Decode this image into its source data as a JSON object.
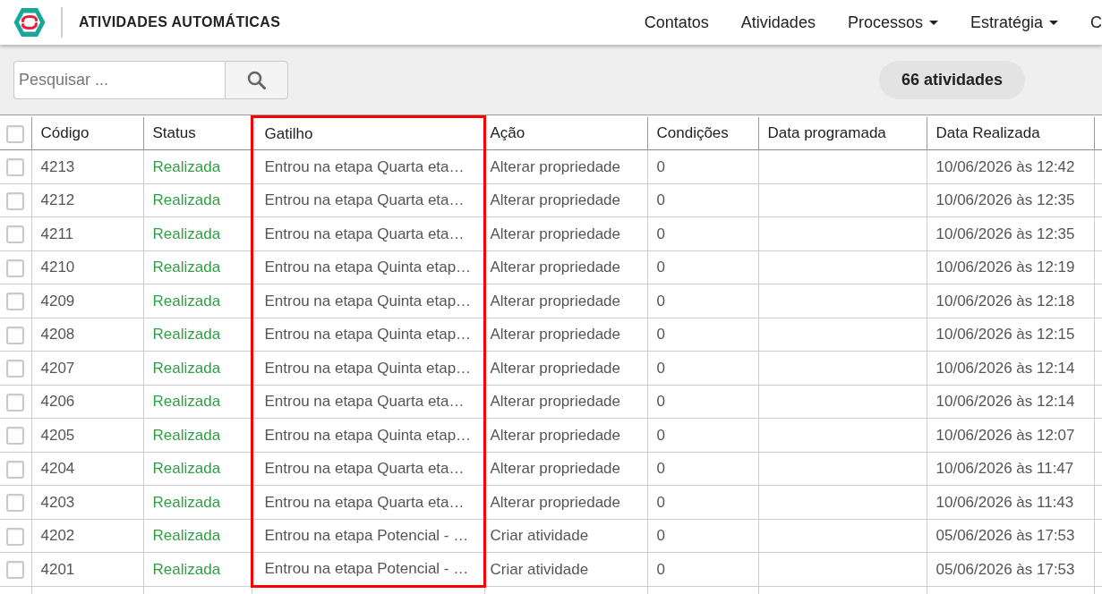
{
  "app": {
    "title": "ATIVIDADES AUTOMÁTICAS"
  },
  "nav": [
    {
      "label": "Contatos",
      "dropdown": false
    },
    {
      "label": "Atividades",
      "dropdown": false
    },
    {
      "label": "Processos",
      "dropdown": true
    },
    {
      "label": "Estratégia",
      "dropdown": true
    },
    {
      "label": "C",
      "dropdown": false
    }
  ],
  "search": {
    "placeholder": "Pesquisar ..."
  },
  "count_badge": "66 atividades",
  "table": {
    "select_all": {
      "checked": false
    },
    "columns": [
      {
        "label": "Código",
        "highlighted": false
      },
      {
        "label": "Status",
        "highlighted": false
      },
      {
        "label": "Gatilho",
        "highlighted": true
      },
      {
        "label": "Ação",
        "highlighted": false
      },
      {
        "label": "Condições",
        "highlighted": false
      },
      {
        "label": "Data programada",
        "highlighted": false
      },
      {
        "label": "Data Realizada",
        "highlighted": false
      }
    ],
    "rows": [
      {
        "checked": false,
        "code": "4213",
        "status": {
          "text": "Realizada",
          "kind": "done"
        },
        "trigger": "Entrou na etapa Quarta eta…",
        "action": "Alterar propriedade",
        "conditions": "0",
        "completed_date": "10/06/2026 às 12:42"
      },
      {
        "checked": false,
        "code": "4212",
        "status": {
          "text": "Realizada",
          "kind": "done"
        },
        "trigger": "Entrou na etapa Quarta eta…",
        "action": "Alterar propriedade",
        "conditions": "0",
        "completed_date": "10/06/2026 às 12:35"
      },
      {
        "checked": false,
        "code": "4211",
        "status": {
          "text": "Realizada",
          "kind": "done"
        },
        "trigger": "Entrou na etapa Quarta eta…",
        "action": "Alterar propriedade",
        "conditions": "0",
        "completed_date": "10/06/2026 às 12:35"
      },
      {
        "checked": false,
        "code": "4210",
        "status": {
          "text": "Realizada",
          "kind": "done"
        },
        "trigger": "Entrou na etapa Quinta etap…",
        "action": "Alterar propriedade",
        "conditions": "0",
        "completed_date": "10/06/2026 às 12:19"
      },
      {
        "checked": false,
        "code": "4209",
        "status": {
          "text": "Realizada",
          "kind": "done"
        },
        "trigger": "Entrou na etapa Quinta etap…",
        "action": "Alterar propriedade",
        "conditions": "0",
        "completed_date": "10/06/2026 às 12:18"
      },
      {
        "checked": false,
        "code": "4208",
        "status": {
          "text": "Realizada",
          "kind": "done"
        },
        "trigger": "Entrou na etapa Quinta etap…",
        "action": "Alterar propriedade",
        "conditions": "0",
        "completed_date": "10/06/2026 às 12:15"
      },
      {
        "checked": false,
        "code": "4207",
        "status": {
          "text": "Realizada",
          "kind": "done"
        },
        "trigger": "Entrou na etapa Quinta etap…",
        "action": "Alterar propriedade",
        "conditions": "0",
        "completed_date": "10/06/2026 às 12:14"
      },
      {
        "checked": false,
        "code": "4206",
        "status": {
          "text": "Realizada",
          "kind": "done"
        },
        "trigger": "Entrou na etapa Quarta eta…",
        "action": "Alterar propriedade",
        "conditions": "0",
        "completed_date": "10/06/2026 às 12:14"
      },
      {
        "checked": false,
        "code": "4205",
        "status": {
          "text": "Realizada",
          "kind": "done"
        },
        "trigger": "Entrou na etapa Quinta etap…",
        "action": "Alterar propriedade",
        "conditions": "0",
        "completed_date": "10/06/2026 às 12:07"
      },
      {
        "checked": false,
        "code": "4204",
        "status": {
          "text": "Realizada",
          "kind": "done"
        },
        "trigger": "Entrou na etapa Quarta eta…",
        "action": "Alterar propriedade",
        "conditions": "0",
        "completed_date": "10/06/2026 às 11:47"
      },
      {
        "checked": false,
        "code": "4203",
        "status": {
          "text": "Realizada",
          "kind": "done"
        },
        "trigger": "Entrou na etapa Quarta eta…",
        "action": "Alterar propriedade",
        "conditions": "0",
        "completed_date": "10/06/2026 às 11:43"
      },
      {
        "checked": false,
        "code": "4202",
        "status": {
          "text": "Realizada",
          "kind": "done"
        },
        "trigger": "Entrou na etapa Potencial - …",
        "action": "Criar atividade",
        "conditions": "0",
        "completed_date": "05/06/2026 às 17:53"
      },
      {
        "checked": false,
        "code": "4201",
        "status": {
          "text": "Realizada",
          "kind": "done"
        },
        "trigger": "Entrou na etapa Potencial - …",
        "action": "Criar atividade",
        "conditions": "0",
        "completed_date": "05/06/2026 às 17:53"
      }
    ]
  }
}
